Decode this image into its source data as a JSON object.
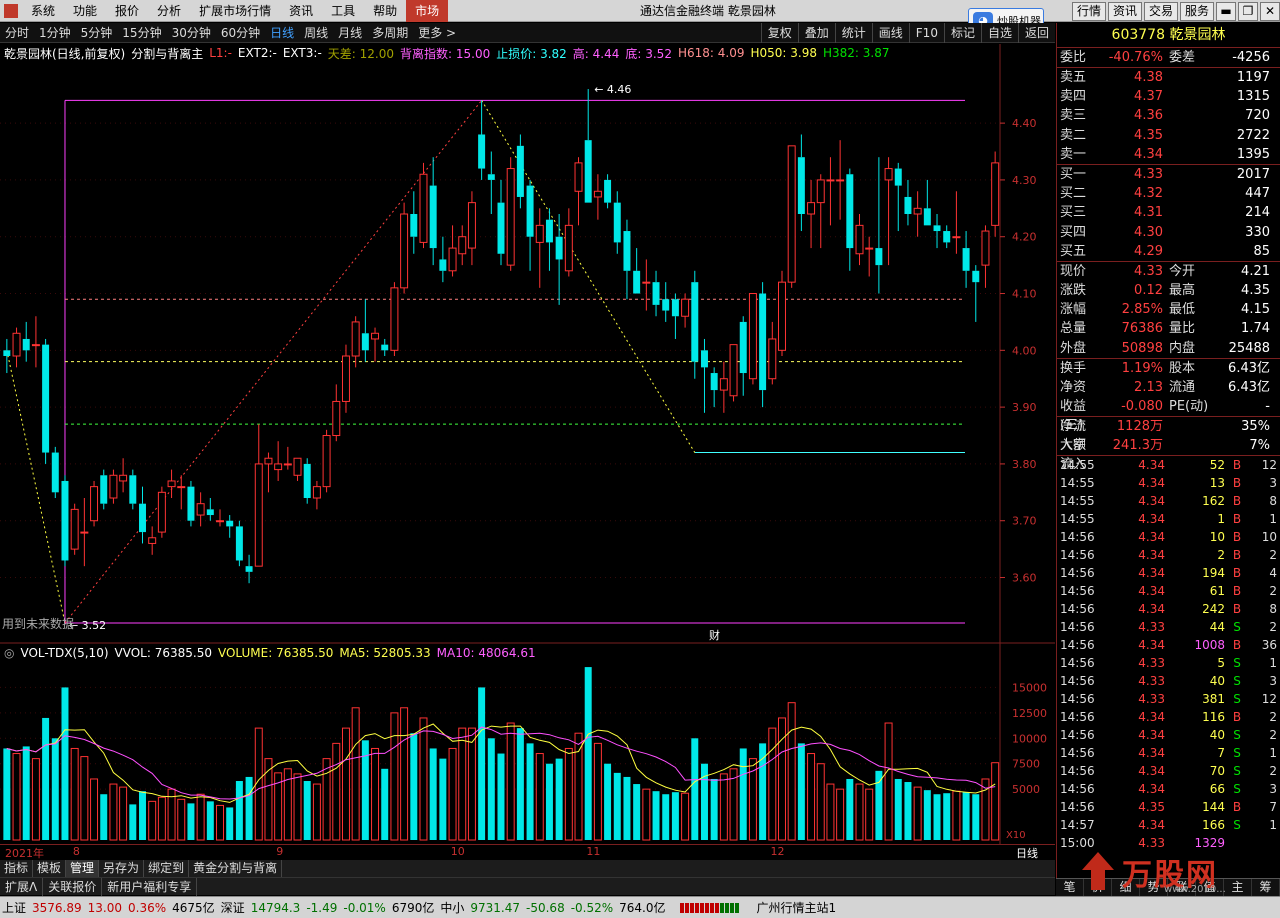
{
  "menu": {
    "items": [
      "系统",
      "功能",
      "报价",
      "分析",
      "扩展市场行情",
      "资讯",
      "工具",
      "帮助"
    ],
    "market": "市场"
  },
  "window_title": "通达信金融终端 乾景园林",
  "top_right_buttons": [
    "行情",
    "资讯",
    "交易",
    "服务"
  ],
  "promo_text": "炒股机器",
  "periods": [
    "分时",
    "1分钟",
    "5分钟",
    "15分钟",
    "30分钟",
    "60分钟",
    "日线",
    "周线",
    "月线",
    "多周期",
    "更多 >"
  ],
  "selected_period": "日线",
  "tools": [
    "复权",
    "叠加",
    "统计",
    "画线",
    "F10",
    "标记",
    "自选",
    "返回"
  ],
  "indicator_line": {
    "name": "乾景园林(日线,前复权)",
    "formula": "分割与背离主",
    "L1": "L1:-",
    "EXT2": "EXT2:-",
    "EXT3": "EXT3:-",
    "tiancha": "天差: 12.00",
    "beili": "背离指数: 15.00",
    "stop": "止损价: 3.82",
    "high": "高: 4.44",
    "low": "底: 3.52",
    "h618": "H618: 4.09",
    "h050": "H050: 3.98",
    "h382": "H382: 3.87"
  },
  "future_note": "用到未来数据",
  "finance_marker": "财",
  "price_axis": {
    "ticks": [
      "4.40",
      "4.30",
      "4.20",
      "4.10",
      "4.00",
      "3.90",
      "3.80",
      "3.70",
      "3.60"
    ],
    "min": 3.49,
    "max": 4.49
  },
  "price_annotations": {
    "top_label": "4.46",
    "bottom_label": "3.52"
  },
  "volume_line": {
    "name": "VOL-TDX(5,10)",
    "vvol": "VVOL: 76385.50",
    "volume": "VOLUME: 76385.50",
    "ma5": "MA5: 52805.33",
    "ma10": "MA10: 48064.61"
  },
  "volume_axis": {
    "ticks": [
      "15000",
      "12500",
      "10000",
      "7500",
      "5000"
    ],
    "unit": "X10",
    "max": 17500
  },
  "x_axis_labels": [
    {
      "label": "2021年",
      "i": 0
    },
    {
      "label": "8",
      "i": 7
    },
    {
      "label": "9",
      "i": 28
    },
    {
      "label": "10",
      "i": 46
    },
    {
      "label": "11",
      "i": 60
    },
    {
      "label": "12",
      "i": 79
    }
  ],
  "period_label": "日线",
  "bottom_tabs": [
    "指标",
    "模板",
    "管理",
    "另存为",
    "绑定到",
    "黄金分割与背离"
  ],
  "bottom_tabs_active": "管理",
  "bottom_tabs2": [
    "扩展ᐱ",
    "关联报价",
    "新用户福利专享"
  ],
  "chart_data": {
    "type": "candlestick",
    "ohlcv": [
      [
        4.0,
        4.02,
        3.96,
        3.99,
        9000
      ],
      [
        3.99,
        4.04,
        3.97,
        4.03,
        8500
      ],
      [
        4.02,
        4.05,
        3.98,
        4.0,
        9200
      ],
      [
        4.01,
        4.06,
        3.97,
        4.01,
        8000
      ],
      [
        4.01,
        4.02,
        3.8,
        3.82,
        12000
      ],
      [
        3.82,
        3.83,
        3.74,
        3.75,
        10000
      ],
      [
        3.77,
        3.78,
        3.62,
        3.63,
        15000
      ],
      [
        3.65,
        3.73,
        3.64,
        3.72,
        9000
      ],
      [
        3.68,
        3.74,
        3.62,
        3.68,
        8200
      ],
      [
        3.7,
        3.77,
        3.69,
        3.76,
        6000
      ],
      [
        3.78,
        3.79,
        3.72,
        3.73,
        4500
      ],
      [
        3.74,
        3.79,
        3.73,
        3.78,
        5500
      ],
      [
        3.77,
        3.81,
        3.75,
        3.78,
        5200
      ],
      [
        3.78,
        3.79,
        3.72,
        3.73,
        3500
      ],
      [
        3.73,
        3.76,
        3.66,
        3.68,
        4800
      ],
      [
        3.66,
        3.69,
        3.64,
        3.67,
        3800
      ],
      [
        3.68,
        3.76,
        3.67,
        3.75,
        4200
      ],
      [
        3.76,
        3.79,
        3.74,
        3.77,
        5000
      ],
      [
        3.76,
        3.78,
        3.72,
        3.76,
        4000
      ],
      [
        3.76,
        3.77,
        3.69,
        3.7,
        3600
      ],
      [
        3.71,
        3.75,
        3.69,
        3.73,
        4500
      ],
      [
        3.72,
        3.74,
        3.7,
        3.71,
        3800
      ],
      [
        3.7,
        3.72,
        3.69,
        3.7,
        3400
      ],
      [
        3.7,
        3.71,
        3.67,
        3.69,
        3200
      ],
      [
        3.69,
        3.7,
        3.62,
        3.63,
        5800
      ],
      [
        3.62,
        3.64,
        3.59,
        3.61,
        6200
      ],
      [
        3.62,
        3.87,
        3.62,
        3.8,
        11000
      ],
      [
        3.8,
        3.82,
        3.75,
        3.81,
        8000
      ],
      [
        3.79,
        3.84,
        3.77,
        3.8,
        6600
      ],
      [
        3.8,
        3.83,
        3.79,
        3.8,
        7000
      ],
      [
        3.78,
        3.81,
        3.77,
        3.81,
        6500
      ],
      [
        3.8,
        3.81,
        3.73,
        3.74,
        5800
      ],
      [
        3.74,
        3.77,
        3.72,
        3.76,
        5500
      ],
      [
        3.76,
        3.86,
        3.75,
        3.85,
        8000
      ],
      [
        3.85,
        3.94,
        3.84,
        3.91,
        9500
      ],
      [
        3.91,
        4.01,
        3.89,
        3.99,
        11000
      ],
      [
        3.99,
        4.06,
        3.97,
        4.05,
        13000
      ],
      [
        4.03,
        4.09,
        3.98,
        4.0,
        9800
      ],
      [
        4.02,
        4.04,
        3.98,
        4.03,
        9000
      ],
      [
        4.01,
        4.02,
        3.99,
        4.0,
        7000
      ],
      [
        4.0,
        4.12,
        3.99,
        4.11,
        12500
      ],
      [
        4.11,
        4.26,
        4.1,
        4.24,
        13000
      ],
      [
        4.24,
        4.28,
        4.17,
        4.2,
        10500
      ],
      [
        4.19,
        4.33,
        4.18,
        4.31,
        12000
      ],
      [
        4.29,
        4.34,
        4.15,
        4.18,
        9000
      ],
      [
        4.16,
        4.2,
        4.12,
        4.14,
        8000
      ],
      [
        4.14,
        4.22,
        4.13,
        4.18,
        9000
      ],
      [
        4.17,
        4.22,
        4.15,
        4.2,
        11000
      ],
      [
        4.18,
        4.28,
        4.15,
        4.26,
        11000
      ],
      [
        4.38,
        4.44,
        4.3,
        4.32,
        15000
      ],
      [
        4.31,
        4.35,
        4.24,
        4.3,
        10000
      ],
      [
        4.26,
        4.3,
        4.15,
        4.17,
        8500
      ],
      [
        4.15,
        4.34,
        4.14,
        4.32,
        11500
      ],
      [
        4.36,
        4.38,
        4.25,
        4.27,
        11000
      ],
      [
        4.29,
        4.3,
        4.14,
        4.2,
        9500
      ],
      [
        4.19,
        4.25,
        4.11,
        4.22,
        8500
      ],
      [
        4.23,
        4.25,
        4.14,
        4.19,
        7500
      ],
      [
        4.2,
        4.24,
        4.08,
        4.16,
        8000
      ],
      [
        4.14,
        4.25,
        4.13,
        4.22,
        9000
      ],
      [
        4.28,
        4.34,
        4.22,
        4.33,
        10500
      ],
      [
        4.37,
        4.46,
        4.26,
        4.26,
        17000
      ],
      [
        4.27,
        4.31,
        4.23,
        4.28,
        9500
      ],
      [
        4.3,
        4.31,
        4.25,
        4.26,
        7500
      ],
      [
        4.26,
        4.28,
        4.17,
        4.19,
        6600
      ],
      [
        4.21,
        4.23,
        4.09,
        4.14,
        6200
      ],
      [
        4.14,
        4.18,
        4.1,
        4.1,
        5500
      ],
      [
        4.12,
        4.16,
        4.07,
        4.12,
        5000
      ],
      [
        4.12,
        4.14,
        4.06,
        4.08,
        4800
      ],
      [
        4.09,
        4.12,
        4.05,
        4.07,
        4500
      ],
      [
        4.09,
        4.1,
        4.02,
        4.06,
        4700
      ],
      [
        4.06,
        4.1,
        4.04,
        4.09,
        4600
      ],
      [
        4.12,
        4.14,
        3.95,
        3.98,
        10000
      ],
      [
        4.0,
        4.02,
        3.89,
        3.97,
        7500
      ],
      [
        3.96,
        3.97,
        3.9,
        3.93,
        6000
      ],
      [
        3.93,
        3.98,
        3.89,
        3.95,
        6500
      ],
      [
        3.92,
        4.0,
        3.91,
        4.01,
        7000
      ],
      [
        4.05,
        4.06,
        3.92,
        3.96,
        9000
      ],
      [
        3.95,
        4.05,
        3.94,
        4.1,
        8000
      ],
      [
        4.1,
        4.12,
        3.9,
        3.93,
        9500
      ],
      [
        3.95,
        4.05,
        3.94,
        4.02,
        11000
      ],
      [
        4.0,
        4.14,
        3.99,
        4.12,
        12000
      ],
      [
        4.12,
        4.36,
        4.11,
        4.36,
        13500
      ],
      [
        4.34,
        4.38,
        4.21,
        4.24,
        9500
      ],
      [
        4.24,
        4.3,
        4.18,
        4.26,
        8500
      ],
      [
        4.26,
        4.31,
        4.18,
        4.3,
        7500
      ],
      [
        4.3,
        4.34,
        4.22,
        4.3,
        5500
      ],
      [
        4.3,
        4.37,
        4.23,
        4.3,
        5000
      ],
      [
        4.31,
        4.32,
        4.14,
        4.18,
        6000
      ],
      [
        4.17,
        4.24,
        4.15,
        4.22,
        5500
      ],
      [
        4.18,
        4.2,
        4.13,
        4.18,
        5000
      ],
      [
        4.18,
        4.34,
        4.1,
        4.15,
        6800
      ],
      [
        4.3,
        4.34,
        4.15,
        4.32,
        11500
      ],
      [
        4.32,
        4.33,
        4.21,
        4.29,
        6000
      ],
      [
        4.27,
        4.3,
        4.22,
        4.24,
        5700
      ],
      [
        4.24,
        4.28,
        4.2,
        4.25,
        5200
      ],
      [
        4.25,
        4.3,
        4.22,
        4.22,
        4900
      ],
      [
        4.22,
        4.24,
        4.18,
        4.21,
        4500
      ],
      [
        4.21,
        4.22,
        4.18,
        4.19,
        4600
      ],
      [
        4.2,
        4.28,
        4.17,
        4.2,
        4800
      ],
      [
        4.18,
        4.21,
        4.11,
        4.14,
        4700
      ],
      [
        4.14,
        4.15,
        4.05,
        4.12,
        4500
      ],
      [
        4.15,
        4.22,
        4.11,
        4.21,
        6000
      ],
      [
        4.22,
        4.35,
        4.2,
        4.33,
        7600
      ]
    ],
    "lines": {
      "H618": 4.09,
      "H050": 3.98,
      "H382": 3.87,
      "top": 4.44,
      "bottom": 3.52,
      "stop": 3.82
    }
  },
  "quote_panel": {
    "code": "603778",
    "name": "乾景园林",
    "weibi": {
      "label": "委比",
      "value": "-40.76%",
      "label2": "委差",
      "value2": "-4256"
    },
    "asks": [
      {
        "l": "卖五",
        "p": "4.38",
        "v": "1197"
      },
      {
        "l": "卖四",
        "p": "4.37",
        "v": "1315"
      },
      {
        "l": "卖三",
        "p": "4.36",
        "v": "720"
      },
      {
        "l": "卖二",
        "p": "4.35",
        "v": "2722"
      },
      {
        "l": "卖一",
        "p": "4.34",
        "v": "1395"
      }
    ],
    "bids": [
      {
        "l": "买一",
        "p": "4.33",
        "v": "2017"
      },
      {
        "l": "买二",
        "p": "4.32",
        "v": "447"
      },
      {
        "l": "买三",
        "p": "4.31",
        "v": "214"
      },
      {
        "l": "买四",
        "p": "4.30",
        "v": "330"
      },
      {
        "l": "买五",
        "p": "4.29",
        "v": "85"
      }
    ],
    "stats": [
      {
        "l": "现价",
        "v": "4.33",
        "vc": "red",
        "l2": "今开",
        "v2": "4.21",
        "v2c": "wht"
      },
      {
        "l": "涨跌",
        "v": "0.12",
        "vc": "red",
        "l2": "最高",
        "v2": "4.35",
        "v2c": "red"
      },
      {
        "l": "涨幅",
        "v": "2.85%",
        "vc": "red",
        "l2": "最低",
        "v2": "4.15",
        "v2c": "grn"
      },
      {
        "l": "总量",
        "v": "76386",
        "vc": "yel",
        "l2": "量比",
        "v2": "1.74",
        "v2c": "red"
      },
      {
        "l": "外盘",
        "v": "50898",
        "vc": "red",
        "l2": "内盘",
        "v2": "25488",
        "v2c": "grn"
      },
      {
        "l": "换手",
        "v": "1.19%",
        "vc": "wht",
        "l2": "股本",
        "v2": "6.43亿",
        "v2c": "wht"
      },
      {
        "l": "净资",
        "v": "2.13",
        "vc": "wht",
        "l2": "流通",
        "v2": "6.43亿",
        "v2c": "wht"
      },
      {
        "l": "收益(三)",
        "v": "-0.080",
        "vc": "wht",
        "l2": "PE(动)",
        "v2": "-",
        "v2c": "wht"
      }
    ],
    "flows": [
      {
        "l": "净流入额",
        "v": "1128万",
        "p": "35%"
      },
      {
        "l": "大宗流入",
        "v": "241.3万",
        "p": "7%"
      }
    ],
    "ticks": [
      [
        "14:55",
        "4.34",
        "52",
        "B",
        "12"
      ],
      [
        "14:55",
        "4.34",
        "13",
        "B",
        "3"
      ],
      [
        "14:55",
        "4.34",
        "162",
        "B",
        "8"
      ],
      [
        "14:55",
        "4.34",
        "1",
        "B",
        "1"
      ],
      [
        "14:56",
        "4.34",
        "10",
        "B",
        "10"
      ],
      [
        "14:56",
        "4.34",
        "2",
        "B",
        "2"
      ],
      [
        "14:56",
        "4.34",
        "194",
        "B",
        "4"
      ],
      [
        "14:56",
        "4.34",
        "61",
        "B",
        "2"
      ],
      [
        "14:56",
        "4.34",
        "242",
        "B",
        "8"
      ],
      [
        "14:56",
        "4.33",
        "44",
        "S",
        "2"
      ],
      [
        "14:56",
        "4.34",
        "1008",
        "B",
        "36"
      ],
      [
        "14:56",
        "4.33",
        "5",
        "S",
        "1"
      ],
      [
        "14:56",
        "4.33",
        "40",
        "S",
        "3"
      ],
      [
        "14:56",
        "4.33",
        "381",
        "S",
        "12"
      ],
      [
        "14:56",
        "4.34",
        "116",
        "B",
        "2"
      ],
      [
        "14:56",
        "4.34",
        "40",
        "S",
        "2"
      ],
      [
        "14:56",
        "4.34",
        "7",
        "S",
        "1"
      ],
      [
        "14:56",
        "4.34",
        "70",
        "S",
        "2"
      ],
      [
        "14:56",
        "4.34",
        "66",
        "S",
        "3"
      ],
      [
        "14:56",
        "4.35",
        "144",
        "B",
        "7"
      ],
      [
        "14:57",
        "4.34",
        "166",
        "S",
        "1"
      ],
      [
        "15:00",
        "4.33",
        "1329",
        "",
        ""
      ]
    ]
  },
  "panel_bottom_tabs": [
    "笔",
    "价",
    "细",
    "势",
    "联",
    "值",
    "主",
    "筹"
  ],
  "watermark": {
    "text": "万股网",
    "url": "www.2010..."
  },
  "status": {
    "sh": {
      "label": "上证",
      "v": "3576.89",
      "c": "13.00",
      "p": "0.36%",
      "a": "4675亿"
    },
    "sz": {
      "label": "深证",
      "v": "14794.3",
      "c": "-1.49",
      "p": "-0.01%",
      "a": "6790亿"
    },
    "zx": {
      "label": "中小",
      "v": "9731.47",
      "c": "-50.68",
      "p": "-0.52%",
      "a": "764.0亿"
    },
    "site": "广州行情主站1"
  },
  "colors": {
    "up": "#ff3333",
    "down": "#00e8e8",
    "ma5": "#ffff40",
    "ma10": "#ff50ff",
    "gold618": "#ff8080",
    "gold050": "#ffff60",
    "gold382": "#40ff40",
    "box": "#ff40ff",
    "stop": "#40ffff"
  }
}
